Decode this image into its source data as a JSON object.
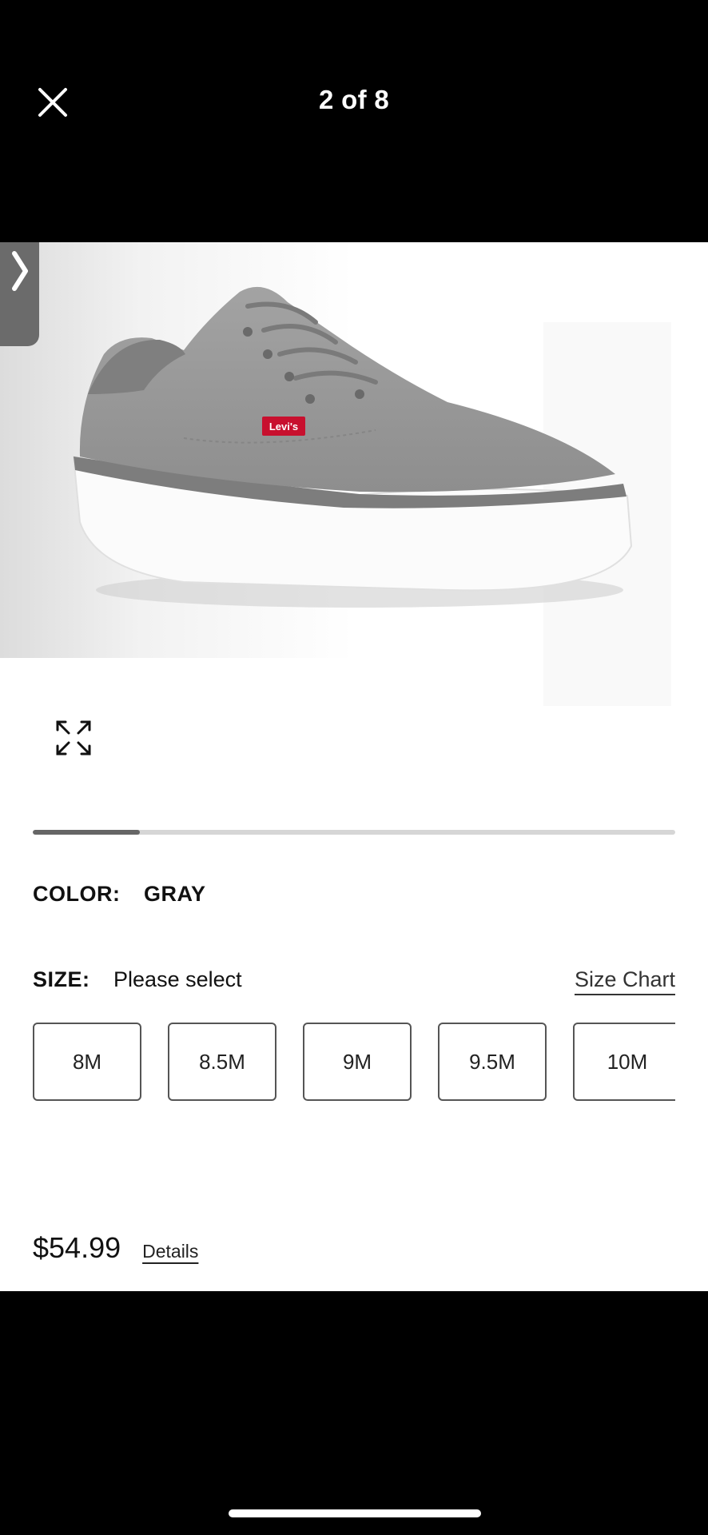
{
  "header": {
    "close_icon": "close-icon",
    "counter": "2 of 8"
  },
  "gallery": {
    "current_image": 2,
    "total_images": 8,
    "progress_fraction": 0.167,
    "logo_text": "Levi's",
    "expand_icon": "expand-icon",
    "next_icon": "chevron-right-icon"
  },
  "product": {
    "color_label": "COLOR:",
    "color_value": "GRAY",
    "size_label": "SIZE:",
    "size_value": "Please select",
    "size_chart_label": "Size Chart",
    "sizes": [
      "8M",
      "8.5M",
      "9M",
      "9.5M",
      "10M"
    ],
    "price": "$54.99",
    "details_label": "Details"
  },
  "colors": {
    "accent": "#c8102e",
    "shoe": "#9b9b9b"
  }
}
